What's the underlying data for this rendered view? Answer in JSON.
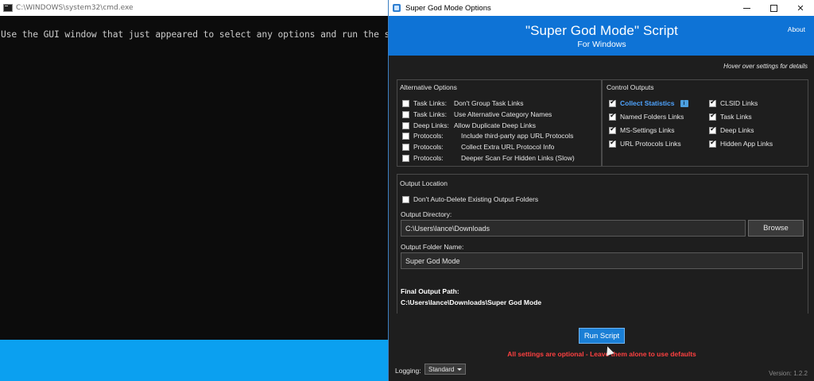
{
  "cmd": {
    "title": "C:\\WINDOWS\\system32\\cmd.exe",
    "text": "Use the GUI window that just appeared to select any options and run the script."
  },
  "window": {
    "title": "Super God Mode Options",
    "minimize": "—",
    "close": "✕"
  },
  "header": {
    "title": "\"Super God Mode\" Script",
    "subtitle": "For Windows",
    "about": "About"
  },
  "hover_hint": "Hover over settings for details",
  "alternative_options": {
    "title": "Alternative Options",
    "items": [
      {
        "key": "Task Links:",
        "value": "Don't Group Task Links",
        "checked": false
      },
      {
        "key": "Task Links:",
        "value": "Use Alternative Category Names",
        "checked": false
      },
      {
        "key": "Deep Links:",
        "value": "Allow Duplicate Deep Links",
        "checked": false
      },
      {
        "key": "Protocols:",
        "value": "Include third-party app URL Protocols",
        "checked": false
      },
      {
        "key": "Protocols:",
        "value": "Collect Extra URL Protocol Info",
        "checked": false
      },
      {
        "key": "Protocols:",
        "value": "Deeper Scan For Hidden Links (Slow)",
        "checked": false
      }
    ]
  },
  "control_outputs": {
    "title": "Control Outputs",
    "left": [
      {
        "label": "Collect Statistics",
        "checked": true
      },
      {
        "label": "Named Folders Links",
        "checked": true
      },
      {
        "label": "MS-Settings Links",
        "checked": true
      },
      {
        "label": "URL Protocols Links",
        "checked": true
      }
    ],
    "right": [
      {
        "label": "CLSID Links",
        "checked": true
      },
      {
        "label": "Task Links",
        "checked": true
      },
      {
        "label": "Deep Links",
        "checked": true
      },
      {
        "label": "Hidden App Links",
        "checked": true
      }
    ],
    "info_badge": "i"
  },
  "output_location": {
    "title": "Output Location",
    "no_delete_label": "Don't Auto-Delete Existing Output Folders",
    "directory_label": "Output Directory:",
    "directory_value": "C:\\Users\\lance\\Downloads",
    "browse": "Browse",
    "folder_label": "Output Folder Name:",
    "folder_value": "Super God Mode",
    "final_label": "Final Output Path:",
    "final_path": "C:\\Users\\lance\\Downloads\\Super God Mode"
  },
  "run_button": "Run Script",
  "warning": "All settings are optional - Leave them alone to use defaults",
  "logging": {
    "label": "Logging:",
    "value": "Standard"
  },
  "version": "Version: 1.2.2"
}
